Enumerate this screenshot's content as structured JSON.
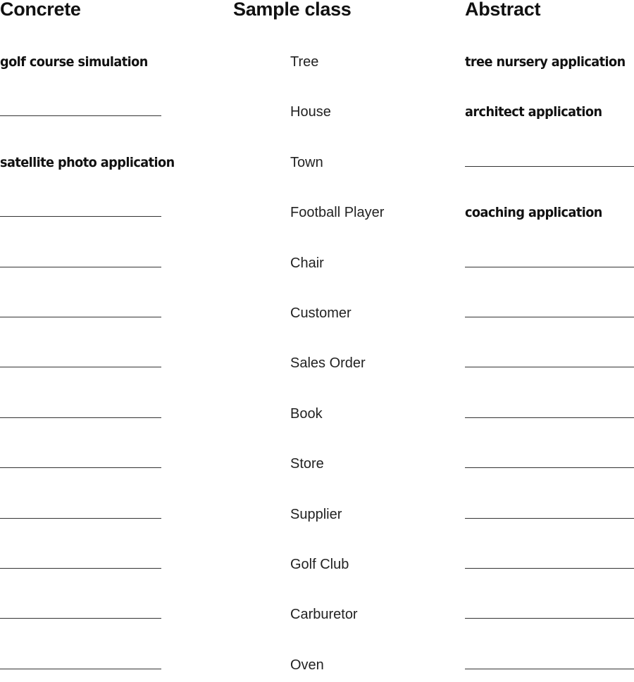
{
  "headers": {
    "concrete": "Concrete",
    "sample": "Sample class",
    "abstract": "Abstract"
  },
  "rows": [
    {
      "concrete": "golf course simulation",
      "sample": "Tree",
      "abstract": "tree nursery application"
    },
    {
      "concrete": "",
      "sample": "House",
      "abstract": "architect application"
    },
    {
      "concrete": "satellite photo application",
      "sample": "Town",
      "abstract": ""
    },
    {
      "concrete": "",
      "sample": "Football Player",
      "abstract": "coaching application"
    },
    {
      "concrete": "",
      "sample": "Chair",
      "abstract": ""
    },
    {
      "concrete": "",
      "sample": "Customer",
      "abstract": ""
    },
    {
      "concrete": "",
      "sample": "Sales Order",
      "abstract": ""
    },
    {
      "concrete": "",
      "sample": "Book",
      "abstract": ""
    },
    {
      "concrete": "",
      "sample": "Store",
      "abstract": ""
    },
    {
      "concrete": "",
      "sample": "Supplier",
      "abstract": ""
    },
    {
      "concrete": "",
      "sample": "Golf Club",
      "abstract": ""
    },
    {
      "concrete": "",
      "sample": "Carburetor",
      "abstract": ""
    },
    {
      "concrete": "",
      "sample": "Oven",
      "abstract": ""
    }
  ]
}
